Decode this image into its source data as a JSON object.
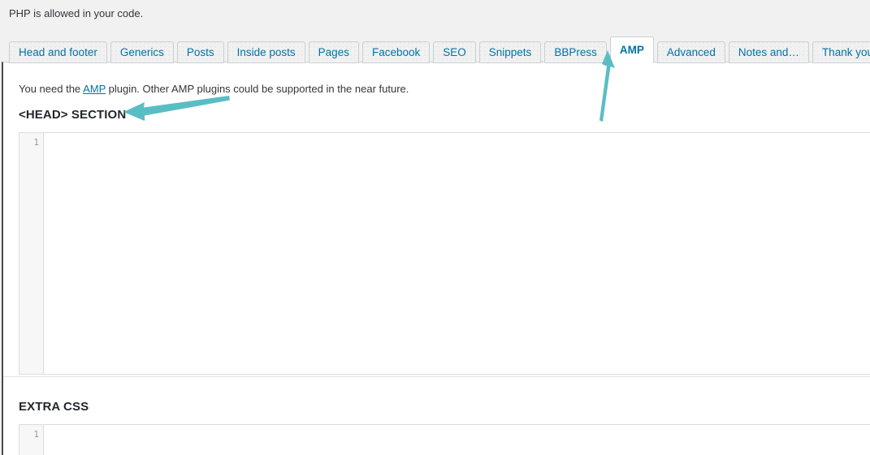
{
  "top_note": "PHP is allowed in your code.",
  "tabs": [
    {
      "label": "Head and footer",
      "active": false
    },
    {
      "label": "Generics",
      "active": false
    },
    {
      "label": "Posts",
      "active": false
    },
    {
      "label": "Inside posts",
      "active": false
    },
    {
      "label": "Pages",
      "active": false
    },
    {
      "label": "Facebook",
      "active": false
    },
    {
      "label": "SEO",
      "active": false
    },
    {
      "label": "Snippets",
      "active": false
    },
    {
      "label": "BBPress",
      "active": false
    },
    {
      "label": "AMP",
      "active": true
    },
    {
      "label": "Advanced",
      "active": false
    },
    {
      "label": "Notes and…",
      "active": false
    },
    {
      "label": "Thank you",
      "active": false
    }
  ],
  "panel": {
    "intro": {
      "before": "You need the ",
      "link": "AMP",
      "after": " plugin. Other AMP plugins could be supported in the near future."
    },
    "head_section": {
      "title": "<HEAD> SECTION",
      "line_number": "1",
      "code": ""
    },
    "extra_css": {
      "title": "EXTRA CSS",
      "line_number": "1",
      "code": ""
    }
  },
  "annotations": {
    "color": "#59bec4",
    "amp_arrow": "arrow-up-to-amp-tab",
    "head_arrow": "arrow-left-to-head-section"
  },
  "colors": {
    "link": "#0073aa",
    "page_background": "#f1f1f1",
    "panel_background": "#ffffff",
    "tab_border": "#ccd0d4",
    "annotation_teal": "#59bec4"
  }
}
